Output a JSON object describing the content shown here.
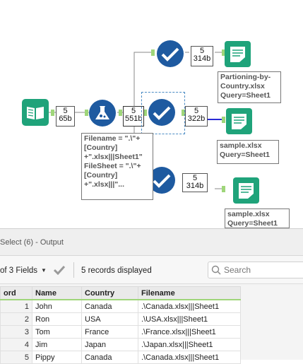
{
  "workflow": {
    "input_badge": {
      "count": "5",
      "size": "65b"
    },
    "formula_badge": {
      "count": "5",
      "size": "551b"
    },
    "output_top_badge": {
      "count": "5",
      "size": "314b"
    },
    "output_mid_badge": {
      "count": "5",
      "size": "322b"
    },
    "output_bottom_badge": {
      "count": "5",
      "size": "314b"
    },
    "formula_annotation": "Filename = \".\\\"+\n[Country]\n+\".xlsx|||Sheet1\"\nFileSheet = \".\\\"+\n[Country]\n+\".xlsx|||\"...",
    "output_top_annotation": "Partioning-by-\nCountry.xlsx\nQuery=Sheet1",
    "output_mid_annotation": "sample.xlsx\nQuery=Sheet1",
    "output_bottom_annotation": "sample.xlsx\nQuery=Sheet1",
    "colors": {
      "tool_blue": "#1e5aa0",
      "tool_green": "#1fa37a",
      "connector": "#8a8a8a",
      "port_green": "#9fd67a",
      "selected_line": "#2a2ad6"
    }
  },
  "results": {
    "title": "Select (6) - Output",
    "fields_selector": "of 3 Fields",
    "records_text": "5 records displayed",
    "search_placeholder": "Search",
    "columns": [
      "ord",
      "Name",
      "Country",
      "Filename"
    ],
    "rows": [
      {
        "n": "1",
        "name": "John",
        "country": "Canada",
        "file": ".\\Canada.xlsx|||Sheet1"
      },
      {
        "n": "2",
        "name": "Ron",
        "country": "USA",
        "file": ".\\USA.xlsx|||Sheet1"
      },
      {
        "n": "3",
        "name": "Tom",
        "country": "France",
        "file": ".\\France.xlsx|||Sheet1"
      },
      {
        "n": "4",
        "name": "Jim",
        "country": "Japan",
        "file": ".\\Japan.xlsx|||Sheet1"
      },
      {
        "n": "5",
        "name": "Pippy",
        "country": "Canada",
        "file": ".\\Canada.xlsx|||Sheet1"
      }
    ]
  }
}
